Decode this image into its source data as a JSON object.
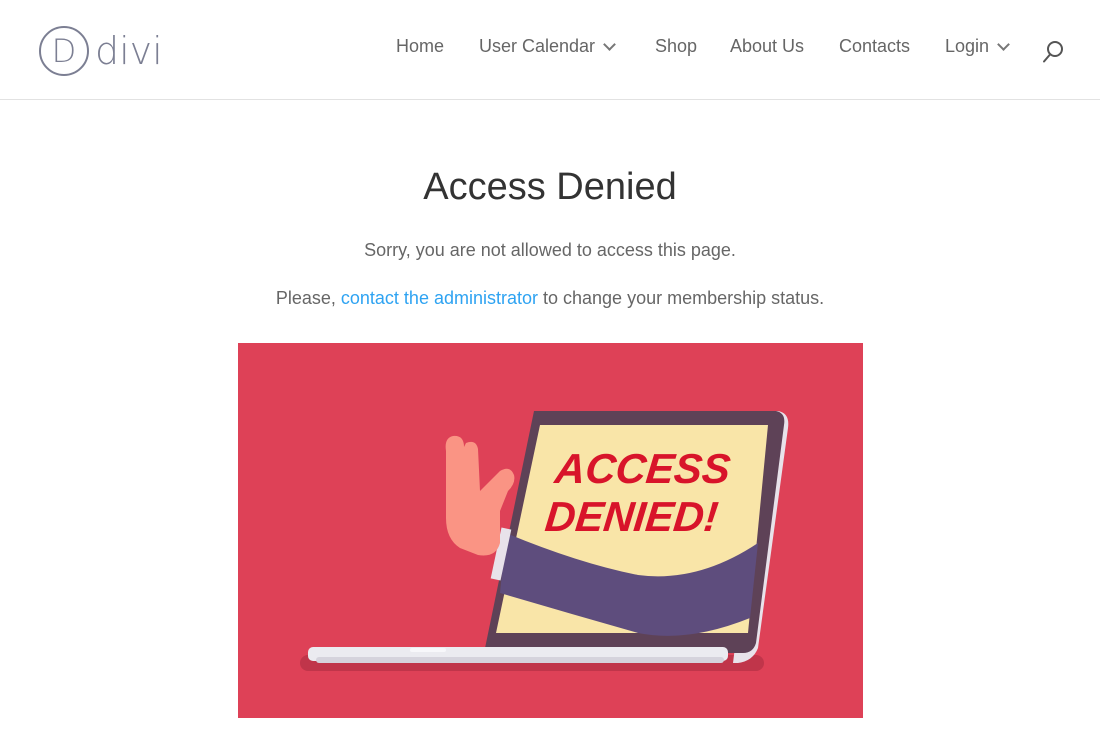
{
  "site": {
    "logo_letter": "D",
    "logo_text": "divi"
  },
  "nav": {
    "items": [
      {
        "label": "Home",
        "has_dropdown": false
      },
      {
        "label": "User Calendar",
        "has_dropdown": true
      },
      {
        "label": "Shop",
        "has_dropdown": false
      },
      {
        "label": "About Us",
        "has_dropdown": false
      },
      {
        "label": "Contacts",
        "has_dropdown": false
      },
      {
        "label": "Login",
        "has_dropdown": true
      }
    ],
    "search_icon": "search-icon"
  },
  "content": {
    "title": "Access Denied",
    "message": "Sorry, you are not allowed to access this page.",
    "contact_prefix": "Please, ",
    "contact_link": "contact the administrator",
    "contact_suffix": " to change your membership status.",
    "image": {
      "description": "Hand reaching out of laptop screen with stop gesture",
      "screen_text_line1": "ACCESS",
      "screen_text_line2": "DENIED!"
    }
  },
  "colors": {
    "banner_bg": "#de4157",
    "link": "#2ea3f2",
    "screen": "#f9e5a8",
    "laptop_frame": "#5e4257",
    "sleeve": "#5e4d7d",
    "hand": "#fa9484",
    "denied_text": "#d8142a"
  }
}
